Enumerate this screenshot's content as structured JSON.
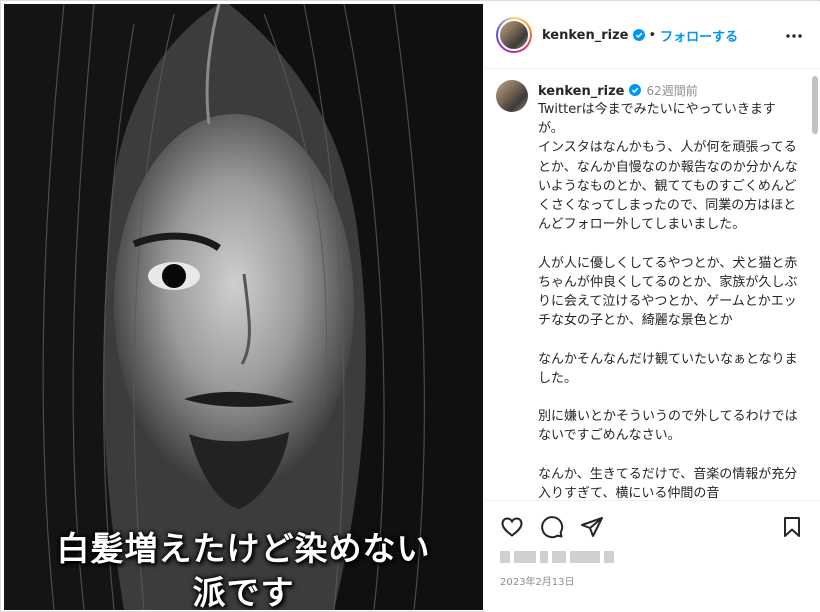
{
  "post": {
    "username": "kenken_rize",
    "follow_label": "フォローする",
    "separator": "•",
    "time_ago": "62週間前",
    "date": "2023年2月13日",
    "body": "Twitterは今までみたいにやっていきますが。\nインスタはなんかもう、人が何を頑張ってるとか、なんか自慢なのか報告なのか分かんないようなものとか、観ててものすごくめんどくさくなってしまったので、同業の方はほとんどフォロー外してしまいました。\n\n人が人に優しくしてるやつとか、犬と猫と赤ちゃんが仲良くしてるのとか、家族が久しぶりに会えて泣けるやつとか、ゲームとかエッチな女の子とか、綺麗な景色とか\n\nなんかそんなんだけ観ていたいなぁとなりました。\n\n別に嫌いとかそういうので外してるわけではないですごめんなさい。\n\nなんか、生きてるだけで、音楽の情報が充分入りすぎて、横にいる仲間の音"
  },
  "photo": {
    "caption_line1": "白髪増えたけど染めない",
    "caption_line2": "派です"
  },
  "icons": {
    "verified": "verified-badge-icon",
    "more": "more-options-icon",
    "like": "heart-icon",
    "comment": "comment-bubble-icon",
    "share": "paper-plane-icon",
    "save": "bookmark-icon"
  },
  "colors": {
    "accent": "#0095f6",
    "text": "#262626",
    "muted": "#8e8e8e"
  }
}
